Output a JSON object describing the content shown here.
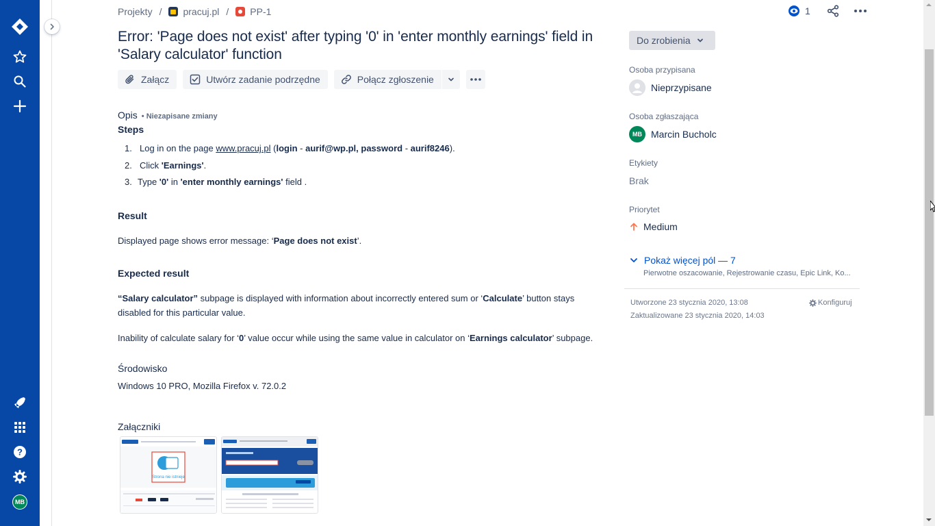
{
  "nav": {
    "icons": [
      "jira-logo-icon",
      "star-icon",
      "search-icon",
      "plus-icon",
      "rocket-icon",
      "apps-grid-icon",
      "help-icon",
      "settings-icon"
    ],
    "avatar_initials": "MB",
    "color": "#0747a6"
  },
  "breadcrumb": {
    "items": [
      "Projekty",
      "pracuj.pl",
      "PP-1"
    ],
    "separator": "/"
  },
  "watchers": {
    "count": "1"
  },
  "issue": {
    "title": "Error: 'Page does not exist' after typing '0' in 'enter monthly earnings' field in 'Salary calculator' function"
  },
  "actions": {
    "attach": "Załącz",
    "subtask": "Utwórz zadanie podrzędne",
    "link": "Połącz zgłoszenie"
  },
  "description": {
    "label": "Opis",
    "unsaved": "• Niezapisane zmiany",
    "steps_heading": "Steps",
    "steps": [
      {
        "num": "1.",
        "pre": "Log in on the page ",
        "link": "www.pracuj.pl",
        "mid1": " (",
        "b1": "login",
        "mid2": " - ",
        "b2": "aurif@wp.pl, password",
        "mid3": " - ",
        "b3": "aurif8246",
        "end": ")."
      },
      {
        "num": "2.",
        "pre": "Click ",
        "b1": "'Earnings'",
        "end": "."
      },
      {
        "num": "3.",
        "pre": "Type ",
        "b1": "'0'",
        "mid1": " in ",
        "b2": "'enter monthly earnings'",
        "end": " field  ."
      }
    ],
    "result_heading": "Result",
    "result_pre": "Displayed page shows error message: ‘",
    "result_bold": "Page does not exist",
    "result_end": "’.",
    "expected_heading": "Expected result",
    "expected_b1": "“Salary calculator”",
    "expected_t1": " subpage is displayed with information about incorrectly entered sum or ‘",
    "expected_b2": "Calculate",
    "expected_t2": "’ button stays disabled for this particular value.",
    "inability_t1": "Inability of calculate salary for ‘",
    "inability_b1": "0",
    "inability_t2": "’ value occur while using the same value in calculator on ‘",
    "inability_b2": "Earnings calculator",
    "inability_t3": "’ subpage."
  },
  "environment": {
    "label": "Środowisko",
    "value": "Windows 10 PRO, Mozilla Firefox v. 72.0.2"
  },
  "attachments": {
    "label": "Załączniki",
    "thumb1_caption": "Strona nie istnieje"
  },
  "sidebar": {
    "status": "Do zrobienia",
    "assignee_label": "Osoba przypisana",
    "assignee": "Nieprzypisane",
    "reporter_label": "Osoba zgłaszająca",
    "reporter": "Marcin Bucholc",
    "reporter_initials": "MB",
    "labels_label": "Etykiety",
    "labels_value": "Brak",
    "priority_label": "Priorytet",
    "priority": "Medium",
    "more_fields": "Pokaż więcej pól — 7",
    "more_fields_sub": "Pierwotne oszacowanie, Rejestrowanie czasu, Epic Link, Ko...",
    "created": "Utworzone 23 stycznia 2020, 13:08",
    "updated": "Zaktualizowane 23 stycznia 2020, 14:03",
    "configure": "Konfiguruj"
  },
  "colors": {
    "link": "#0052cc",
    "priority_medium": "#ff7452",
    "avatar_green": "#00875a"
  }
}
